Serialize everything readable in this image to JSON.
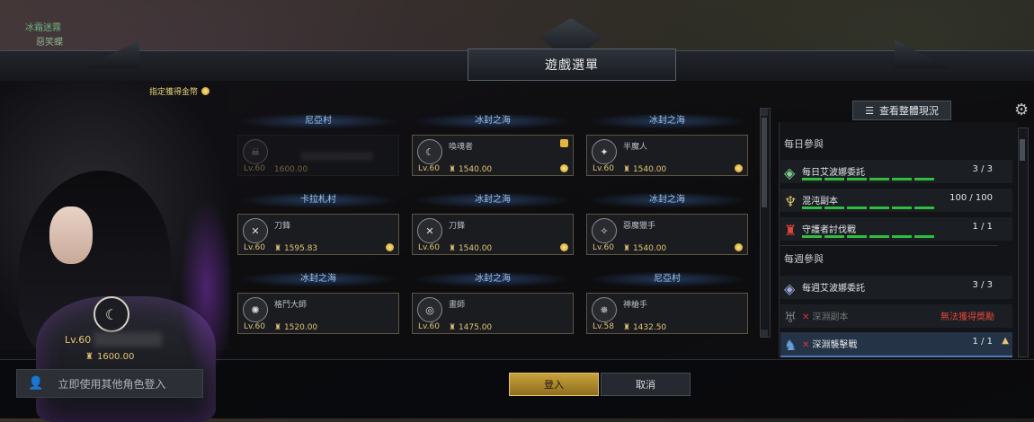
{
  "window": {
    "title": "遊戲選單"
  },
  "hud": {
    "top_left_1": "冰霜迷霧",
    "top_left_2": "惡笑蝶"
  },
  "hint": {
    "text": "指定獲得金幣"
  },
  "selected_character": {
    "level": "Lv.60",
    "item_level": "1600.00"
  },
  "other_login": {
    "label": "立即使用其他角色登入"
  },
  "regions": [
    "尼亞村",
    "冰封之海",
    "冰封之海",
    "卡拉札村",
    "冰封之海",
    "冰封之海",
    "冰封之海",
    "冰封之海",
    "尼亞村"
  ],
  "characters": [
    {
      "class": "喚魂者",
      "level": "Lv.60",
      "item_level": "1540.00"
    },
    {
      "class": "半魔人",
      "level": "Lv.60",
      "item_level": "1540.00"
    },
    {
      "class": "刀鋒",
      "level": "Lv.60",
      "item_level": "1595.83"
    },
    {
      "class": "刀鋒",
      "level": "Lv.60",
      "item_level": "1540.00"
    },
    {
      "class": "惡魔獵手",
      "level": "Lv.60",
      "item_level": "1540.00"
    },
    {
      "class": "格鬥大師",
      "level": "Lv.60",
      "item_level": "1520.00"
    },
    {
      "class": "畫師",
      "level": "Lv.60",
      "item_level": "1475.00"
    },
    {
      "class": "神槍手",
      "level": "Lv.58",
      "item_level": "1432.50"
    }
  ],
  "dim_card": {
    "level": "Lv.60",
    "item_level": "1600.00"
  },
  "right": {
    "overview_button": "查看整體現況",
    "daily_title": "每日參與",
    "weekly_title": "每週參與",
    "daily": [
      {
        "label": "每日艾波娜委託",
        "value": "3 / 3"
      },
      {
        "label": "混沌副本",
        "value": "100 / 100"
      },
      {
        "label": "守護者討伐戰",
        "value": "1 / 1"
      }
    ],
    "weekly": [
      {
        "label": "每週艾波娜委託",
        "value": "3 / 3"
      },
      {
        "label": "深淵副本",
        "value": "無法獲得獎勵"
      },
      {
        "label": "深淵襲擊戰",
        "value": "1 / 1"
      }
    ]
  },
  "buttons": {
    "login": "登入",
    "cancel": "取消"
  },
  "colors": {
    "accent_gold": "#e3c375",
    "progress_green": "#2fbe3d",
    "warning_red": "#e0463c",
    "region_blue": "#9ac1ee"
  }
}
